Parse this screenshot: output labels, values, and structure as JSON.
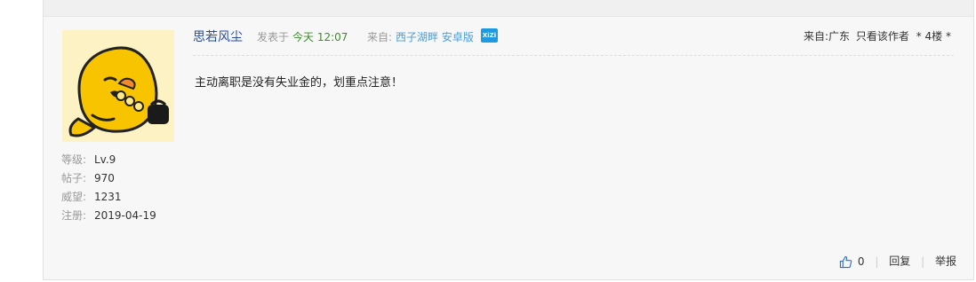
{
  "post": {
    "user": {
      "name": "思若风尘",
      "avatar_icon": "yellow-duck-avatar",
      "stats": [
        {
          "label": "等级:",
          "value": "Lv.9"
        },
        {
          "label": "帖子:",
          "value": "970"
        },
        {
          "label": "威望:",
          "value": "1231"
        },
        {
          "label": "注册:",
          "value": "2019-04-19"
        }
      ]
    },
    "header": {
      "posted_label": "发表于",
      "posted_time": "今天 12:07",
      "source_label": "来自:",
      "source_client": "西子湖畔 安卓版",
      "badge_text": "XiZi",
      "location": "来自:广东",
      "view_op_label": "只看该作者",
      "floor": "* 4楼 *"
    },
    "content": "主动离职是没有失业金的，划重点注意！",
    "footer": {
      "like_count": "0",
      "reply_label": "回复",
      "report_label": "举报"
    },
    "colors": {
      "username": "#2a4d9a",
      "time": "#3d8b2c",
      "client_link": "#4a9ed6",
      "badge": "#1e9be0"
    }
  }
}
